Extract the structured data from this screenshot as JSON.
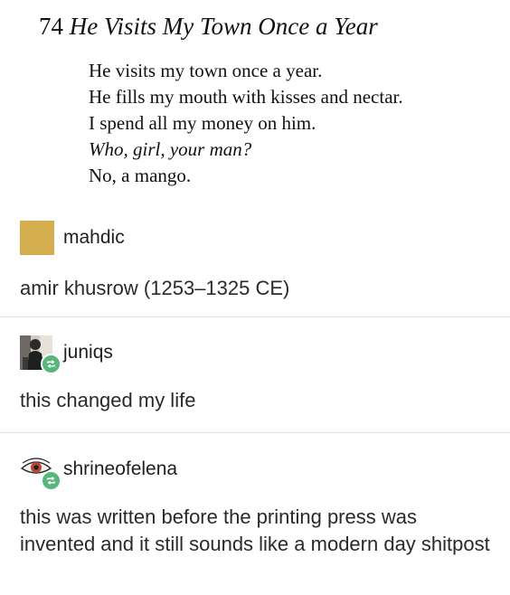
{
  "poem": {
    "number": "74",
    "title": "He Visits My Town Once a Year",
    "lines": [
      {
        "text": "He visits my town once a year.",
        "italic": false
      },
      {
        "text": "He fills my mouth with kisses and nectar.",
        "italic": false
      },
      {
        "text": "I spend all my money on him.",
        "italic": false
      },
      {
        "text": "Who, girl, your man?",
        "italic": true
      },
      {
        "text": "No, a mango.",
        "italic": false
      }
    ]
  },
  "posts": [
    {
      "username": "mahdic",
      "text": "amir khusrow (1253–1325 CE)",
      "avatar": "square-avatar",
      "avatar_color": "#d4ae4c",
      "reblogged": false
    },
    {
      "username": "juniqs",
      "text": "this changed my life",
      "avatar": "photo-avatar",
      "reblogged": true
    },
    {
      "username": "shrineofelena",
      "text": "this was written before the printing press was invented and it still sounds like a modern day shitpost",
      "avatar": "eye-avatar",
      "reblogged": true
    }
  ],
  "colors": {
    "reblog_badge": "#56b77a",
    "divider": "#e3e3e3"
  }
}
